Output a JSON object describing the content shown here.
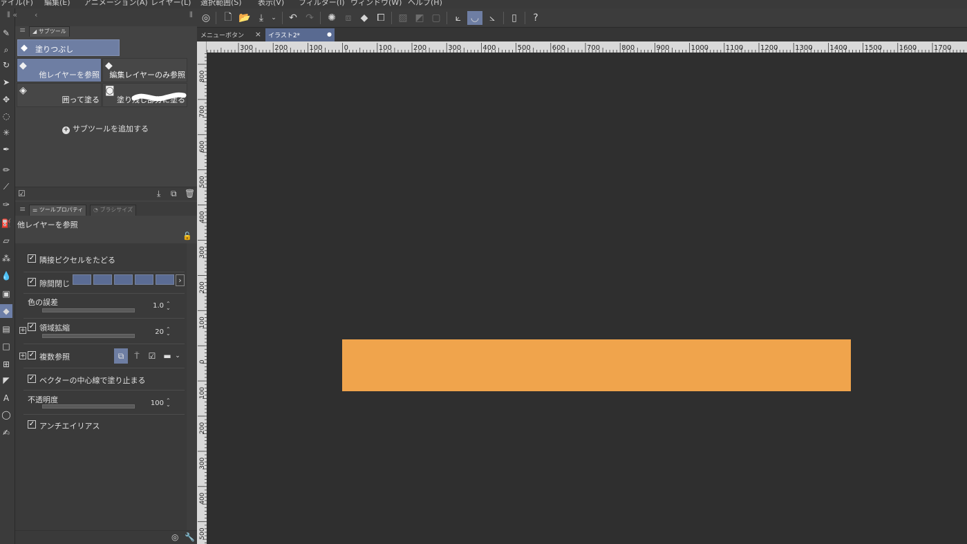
{
  "menu": {
    "items": [
      "ァイル(F)",
      "編集(E)",
      "アニメーション(A)",
      "レイヤー(L)",
      "選択範囲(S)",
      "表示(V)",
      "フィルター(I)",
      "ウィンドウ(W)",
      "ヘルプ(H)"
    ]
  },
  "subtool_panel": {
    "tab_label": "サブツール",
    "group_label": "塗りつぶし",
    "items": [
      {
        "label": "他レイヤーを参照",
        "selected": true
      },
      {
        "label": "編集レイヤーのみ参照",
        "selected": false
      },
      {
        "label": "囲って塗る",
        "selected": false
      },
      {
        "label": "塗り残し部分に塗る",
        "selected": false
      }
    ],
    "add_label": "サブツールを追加する"
  },
  "tool_property": {
    "tab_label": "ツールプロパティ",
    "tab2_label": "ブラシサイズ",
    "title": "他レイヤーを参照",
    "follow_adjacent": {
      "label": "隣接ピクセルをたどる",
      "checked": true
    },
    "close_gap": {
      "label": "隙間閉じ",
      "checked": true,
      "level": 5
    },
    "color_margin": {
      "label": "色の誤差",
      "value": "1.0",
      "fraction": 0.01
    },
    "area_scaling": {
      "label": "領域拡縮",
      "value": "20",
      "checked": true,
      "fraction": 0.2
    },
    "multiple_ref": {
      "label": "複数参照",
      "checked": true
    },
    "vector_stop": {
      "label": "ベクターの中心線で塗り止まる",
      "checked": true
    },
    "opacity": {
      "label": "不透明度",
      "value": "100",
      "fraction": 1.0
    },
    "antialias": {
      "label": "アンチエイリアス",
      "checked": true
    }
  },
  "canvas_tabs": [
    {
      "label": "メニューボタン",
      "active": false
    },
    {
      "label": "イラスト2*",
      "active": true
    }
  ],
  "ruler": {
    "h_labels": [
      "300",
      "200",
      "100",
      "0",
      "100",
      "200",
      "300",
      "400",
      "500",
      "600",
      "700",
      "800",
      "900",
      "1000",
      "1100",
      "1200",
      "1300",
      "1400",
      "1500",
      "1600",
      "1700"
    ],
    "v_labels": [
      "800",
      "700",
      "600",
      "500",
      "400",
      "300",
      "200",
      "100",
      "0",
      "100",
      "200",
      "300",
      "400",
      "500"
    ]
  },
  "colors": {
    "accent": "#6e7ea3",
    "canvas_bg": "#2f2f2f",
    "rect_fill": "#f0a44c"
  }
}
